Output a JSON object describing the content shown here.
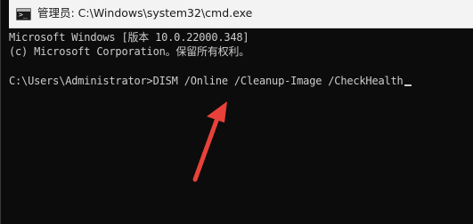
{
  "window": {
    "title": "管理员: C:\\Windows\\system32\\cmd.exe",
    "icon": "cmd-icon"
  },
  "console": {
    "line1": "Microsoft Windows [版本 10.0.22000.348]",
    "line2": "(c) Microsoft Corporation。保留所有权利。",
    "prompt": "C:\\Users\\Administrator>",
    "command": "DISM /Online /Cleanup-Image /CheckHealth"
  },
  "colors": {
    "console_bg": "#0c0c0c",
    "console_text": "#cccccc",
    "titlebar_bg": "#f3f3f3",
    "annotation_arrow": "#e8413a"
  }
}
